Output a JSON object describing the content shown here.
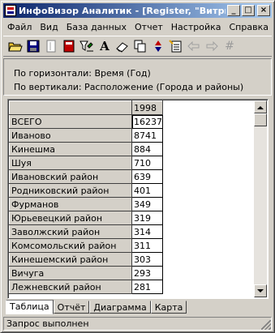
{
  "window": {
    "title": "ИнфоВизор Аналитик - [Register, \"Витри..."
  },
  "title_buttons": {
    "minimize": "_",
    "maximize": "□",
    "close": "×"
  },
  "menu": [
    {
      "label": "Файл"
    },
    {
      "label": "Вид"
    },
    {
      "label": "База данных"
    },
    {
      "label": "Отчет"
    },
    {
      "label": "Настройка"
    },
    {
      "label": "Справка"
    }
  ],
  "toolbar": {
    "icons": [
      "open-folder",
      "save-disk",
      "page",
      "calculator",
      "filter-funnel",
      "font-a",
      "eraser",
      "copy-pages",
      "sort-arrows",
      "wizard-paper",
      "arrow-left",
      "arrow-right",
      "hash"
    ],
    "text_font_glyph": "A",
    "hash_glyph": "#"
  },
  "info": {
    "horizontal": "По горизонтали: Время (Год)",
    "vertical": "По вертикали: Расположение (Города и районы)"
  },
  "grid": {
    "column_header": "1998",
    "rows": [
      {
        "label": "ВСЕГО",
        "value": "16237"
      },
      {
        "label": "Иваново",
        "value": "8741"
      },
      {
        "label": "Кинешма",
        "value": "884"
      },
      {
        "label": "Шуя",
        "value": "710"
      },
      {
        "label": "Ивановский район",
        "value": "639"
      },
      {
        "label": "Родниковский район",
        "value": "401"
      },
      {
        "label": "Фурманов",
        "value": "349"
      },
      {
        "label": "Юрьевецкий район",
        "value": "319"
      },
      {
        "label": "Заволжский район",
        "value": "314"
      },
      {
        "label": "Комсомольский район",
        "value": "311"
      },
      {
        "label": "Кинешемский район",
        "value": "303"
      },
      {
        "label": "Вичуга",
        "value": "293"
      },
      {
        "label": "Лежневский район",
        "value": "281"
      }
    ]
  },
  "tabs": [
    {
      "label": "Таблица",
      "active": true
    },
    {
      "label": "Отчёт",
      "active": false
    },
    {
      "label": "Диаграмма",
      "active": false
    },
    {
      "label": "Карта",
      "active": false
    }
  ],
  "status": {
    "text": "Запрос выполнен"
  },
  "colors": {
    "titlebar_start": "#0a246a",
    "titlebar_end": "#a6caf0",
    "face": "#d4d0c8"
  }
}
